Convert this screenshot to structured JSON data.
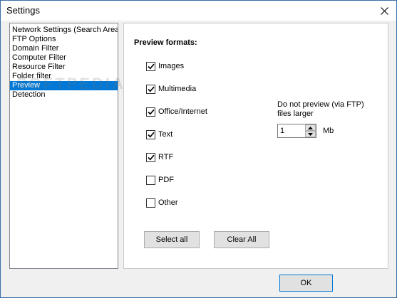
{
  "window": {
    "title": "Settings"
  },
  "icons": {
    "close": "close-icon",
    "check": "checkmark-icon",
    "spin_up": "triangle-up-icon",
    "spin_down": "triangle-down-icon"
  },
  "sidebar": {
    "items": [
      {
        "label": "Network Settings (Search Area",
        "selected": false
      },
      {
        "label": "FTP Options",
        "selected": false
      },
      {
        "label": "Domain Filter",
        "selected": false
      },
      {
        "label": "Computer Filter",
        "selected": false
      },
      {
        "label": "Resource Filter",
        "selected": false
      },
      {
        "label": "Folder filter",
        "selected": false
      },
      {
        "label": "Preview",
        "selected": true
      },
      {
        "label": "Detection",
        "selected": false
      }
    ]
  },
  "watermark": "SOFTPEDIA",
  "preview": {
    "title": "Preview formats:",
    "formats": [
      {
        "label": "Images",
        "checked": true
      },
      {
        "label": "Multimedia",
        "checked": true
      },
      {
        "label": "Office/Internet",
        "checked": true
      },
      {
        "label": "Text",
        "checked": true
      },
      {
        "label": "RTF",
        "checked": true
      },
      {
        "label": "PDF",
        "checked": false
      },
      {
        "label": "Other",
        "checked": false
      }
    ],
    "ftp_limit_label": "Do not preview (via FTP) files larger",
    "ftp_limit_value": "1",
    "ftp_limit_unit": "Mb",
    "select_all_label": "Select all",
    "clear_all_label": "Clear All"
  },
  "footer": {
    "ok_label": "OK"
  },
  "colors": {
    "selection": "#0078d7",
    "window_bg": "#f0f0f0",
    "accent_border": "#0078d7"
  }
}
